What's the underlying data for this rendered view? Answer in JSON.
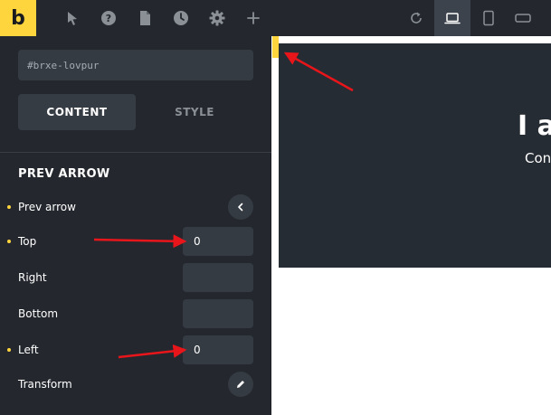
{
  "toolbar": {
    "logo": "b",
    "icons": [
      "pointer-icon",
      "help-icon",
      "pages-icon",
      "history-icon",
      "gear-icon",
      "plus-icon",
      "refresh-icon",
      "laptop-icon",
      "tablet-icon",
      "mobile-landscape-icon"
    ]
  },
  "element": {
    "id_value": "#brxe-lovpur"
  },
  "tabs": {
    "content": "CONTENT",
    "style": "STYLE"
  },
  "section": {
    "title": "PREV ARROW",
    "fields": {
      "prev_arrow": "Prev arrow",
      "top": {
        "label": "Top",
        "value": "0"
      },
      "right": {
        "label": "Right",
        "value": ""
      },
      "bottom": {
        "label": "Bottom",
        "value": ""
      },
      "left": {
        "label": "Left",
        "value": "0"
      },
      "transform": "Transform"
    }
  },
  "canvas": {
    "heading": "I a",
    "text": "Con"
  },
  "colors": {
    "accent": "#ffd53e",
    "panel": "#24282e",
    "input": "#353b42",
    "annotation_arrow": "#e8151b"
  }
}
